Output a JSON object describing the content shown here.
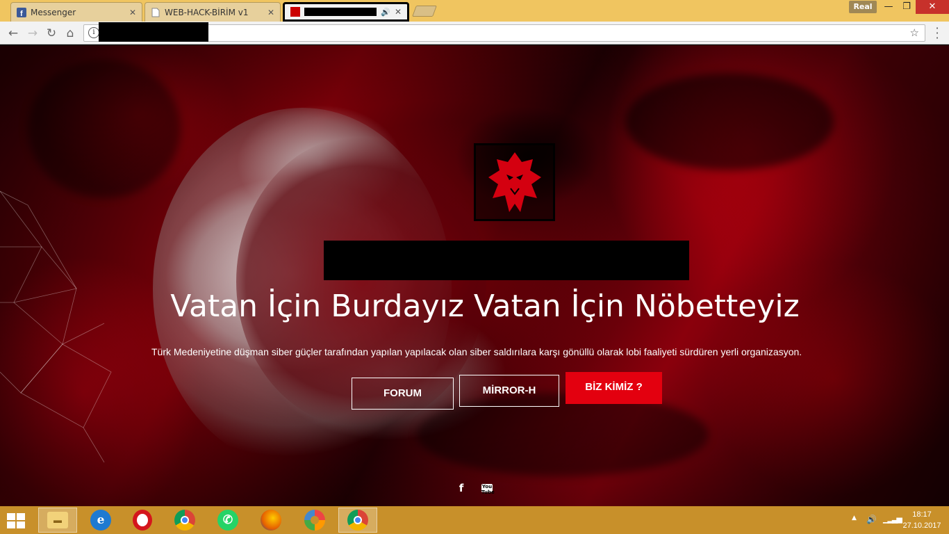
{
  "browser": {
    "tabs": [
      {
        "title": "Messenger",
        "favicon": "facebook-icon",
        "active": false
      },
      {
        "title": "WEB-HACK-BİRİM v1",
        "favicon": "page-icon",
        "active": false
      },
      {
        "title": "",
        "favicon": "page-icon",
        "active": true,
        "redacted": true,
        "audio": true
      }
    ],
    "profile_badge": "Real",
    "url": ""
  },
  "page": {
    "headline": "Vatan İçin Burdayız Vatan İçin Nöbetteyiz",
    "subline": "Türk Medeniyetine düşman siber güçler tarafından yapılan yapılacak olan siber saldırılara karşı gönüllü olarak lobi faaliyeti sürdüren yerli organizasyon.",
    "buttons": {
      "forum": "FORUM",
      "mirror": "MİRROR-H",
      "about": "BİZ KİMİZ ?"
    },
    "social": {
      "facebook": "f",
      "youtube": "You Tube"
    }
  },
  "taskbar": {
    "apps": [
      "file-explorer-icon",
      "internet-explorer-icon",
      "opera-icon",
      "chrome-icon",
      "whatsapp-icon",
      "firefox-icon",
      "picasa-icon",
      "chrome-user-icon"
    ],
    "time": "18:17",
    "date": "27.10.2017"
  },
  "colors": {
    "accent_red": "#e3000f",
    "taskbar": "#c8902a",
    "tabstrip": "#f0c560"
  }
}
